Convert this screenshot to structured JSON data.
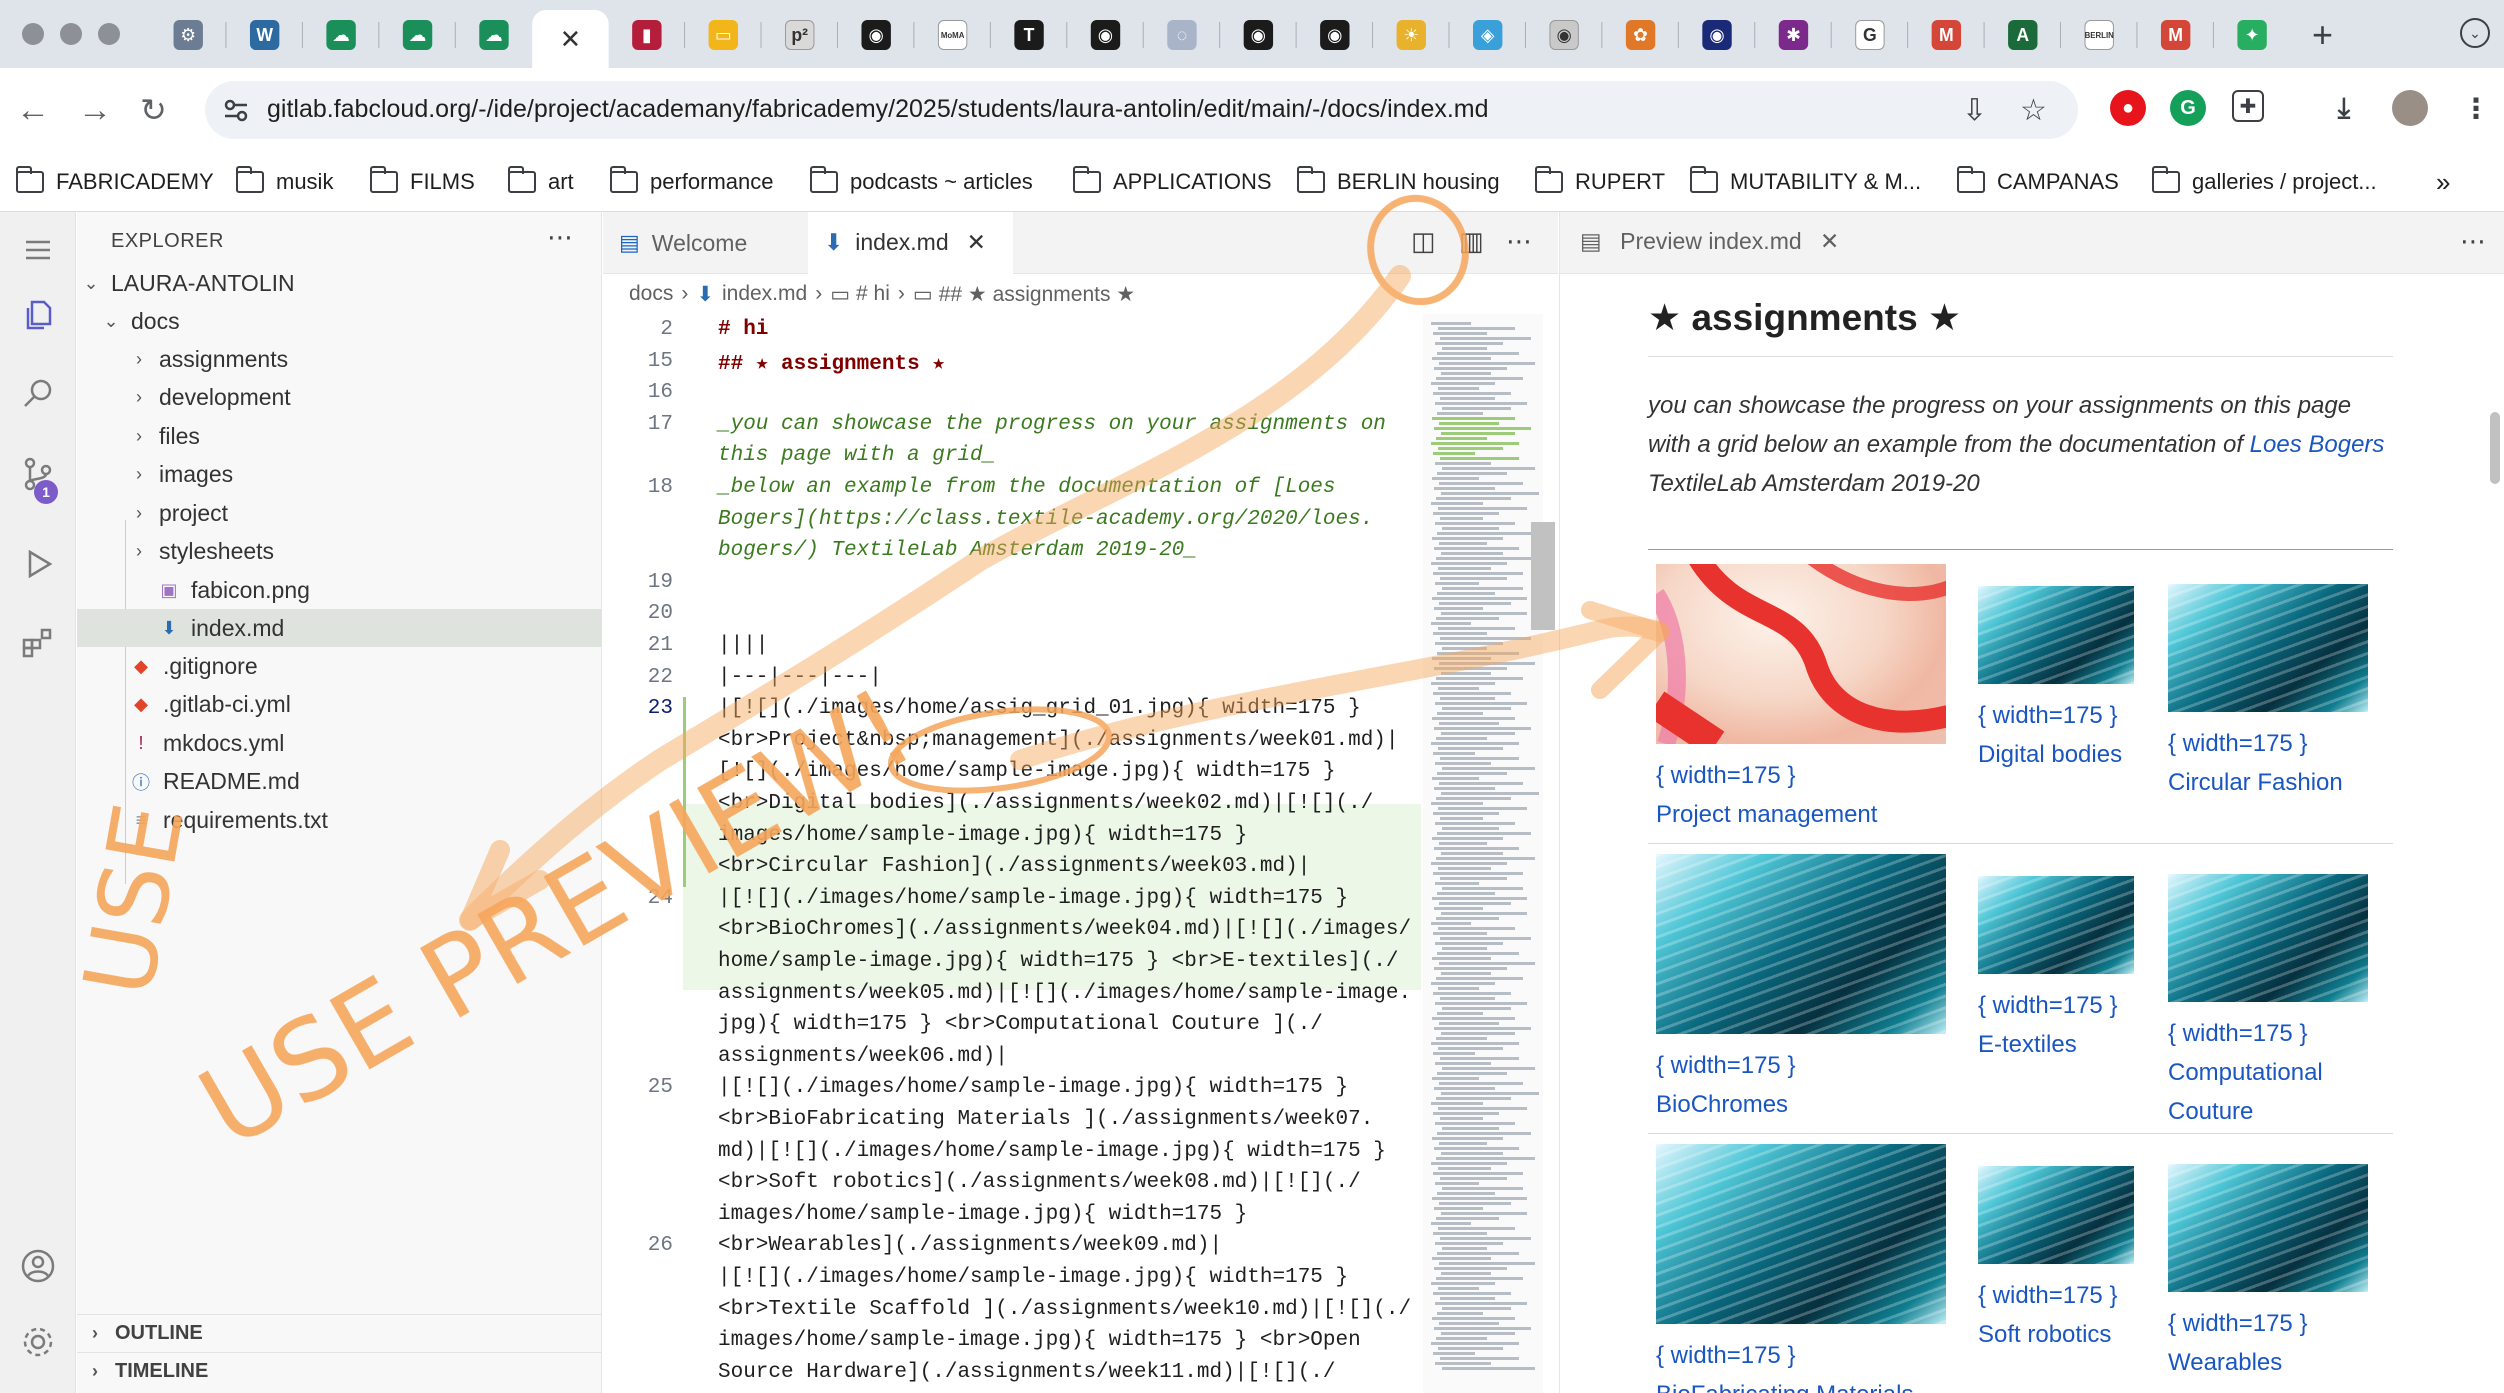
{
  "browser": {
    "tab_icons": [
      "settings-favicon",
      "wordpress-favicon",
      "cloud-favicon",
      "cloud-favicon",
      "cloud-favicon",
      "ide-favicon-active",
      "chart-favicon",
      "slides-favicon",
      "p2-favicon",
      "notion-favicon",
      "moma-favicon",
      "text-favicon",
      "notion-favicon",
      "loading-favicon",
      "notion-favicon",
      "notion-favicon",
      "sun-favicon",
      "cube-favicon",
      "panda-favicon",
      "bird-favicon",
      "circle-favicon",
      "slack-favicon",
      "google-favicon",
      "gmail-favicon",
      "a-favicon",
      "berlin-favicon",
      "gmail-favicon",
      "puzzle-favicon"
    ],
    "address": "gitlab.fabcloud.org/-/ide/project/academany/fabricademy/2025/students/laura-antolin/edit/main/-/docs/index.md",
    "bookmarks": [
      "FABRICADEMY",
      "musik",
      "FILMS",
      "art",
      "performance",
      "podcasts ~ articles",
      "APPLICATIONS",
      "BERLIN housing",
      "RUPERT",
      "MUTABILITY & M...",
      "CAMPANAS",
      "galleries / project..."
    ],
    "more_bookmarks": "»"
  },
  "sidebar": {
    "title": "EXPLORER",
    "root": "LAURA-ANTOLIN",
    "docs_folder": "docs",
    "docs_children": [
      "assignments",
      "development",
      "files",
      "images",
      "project",
      "stylesheets"
    ],
    "docs_files": [
      "fabicon.png",
      "index.md"
    ],
    "root_files": [
      ".gitignore",
      ".gitlab-ci.yml",
      "mkdocs.yml",
      "README.md",
      "requirements.txt"
    ],
    "outline": "OUTLINE",
    "timeline": "TIMELINE",
    "scm_badge": "1"
  },
  "editor": {
    "tabs": [
      "Welcome",
      "index.md"
    ],
    "breadcrumb": [
      "docs",
      "index.md",
      "# hi",
      "## ★ assignments ★"
    ],
    "line_numbers": [
      "2",
      "15",
      "16",
      "17",
      "",
      "18",
      "",
      "",
      "19",
      "20",
      "21",
      "22",
      "23",
      "",
      "",
      "",
      "",
      "",
      "24",
      "",
      "",
      "",
      "",
      "",
      "25",
      "",
      "",
      "",
      "",
      "26",
      "",
      "",
      ""
    ],
    "lines": [
      "# hi",
      "## ★ assignments ★",
      "",
      "_you can showcase the progress on your assignments on",
      "this page with a grid_",
      "_below an example from the documentation of [Loes",
      "Bogers](https://class.textile-academy.org/2020/loes.",
      "bogers/) TextileLab Amsterdam 2019-20_",
      "",
      "",
      "||||",
      "|---|---|---|",
      "|[![](./images/home/assig_grid_01.jpg){ width=175 }",
      "<br>Project&nbsp;management](./assignments/week01.md)|",
      "[![](./images/home/sample-image.jpg){ width=175 }",
      "<br>Digital bodies](./assignments/week02.md)|[![](./",
      "images/home/sample-image.jpg){ width=175 }",
      "<br>Circular Fashion](./assignments/week03.md)|",
      "|[![](./images/home/sample-image.jpg){ width=175 }",
      "<br>BioChromes](./assignments/week04.md)|[![](./images/",
      "home/sample-image.jpg){ width=175 } <br>E-textiles](./",
      "assignments/week05.md)|[![](./images/home/sample-image.",
      "jpg){ width=175 } <br>Computational Couture ](./",
      "assignments/week06.md)|",
      "|[![](./images/home/sample-image.jpg){ width=175 }",
      "<br>BioFabricating Materials ](./assignments/week07.",
      "md)|[![](./images/home/sample-image.jpg){ width=175 }",
      "<br>Soft robotics](./assignments/week08.md)|[![](./",
      "images/home/sample-image.jpg){ width=175 }",
      "<br>Wearables](./assignments/week09.md)|",
      "|[![](./images/home/sample-image.jpg){ width=175 }",
      "<br>Textile Scaffold ](./assignments/week10.md)|[![](./",
      "images/home/sample-image.jpg){ width=175 } <br>Open",
      "Source Hardware](./assignments/week11.md)|[![](./"
    ]
  },
  "preview": {
    "tab": "Preview index.md",
    "heading": "★ assignments ★",
    "intro_before_link": "you can showcase the progress on your assignments on this page with a grid below an example from the documentation of ",
    "intro_link": "Loes Bogers",
    "intro_after_link": " TextileLab Amsterdam 2019-20",
    "width_label": "{ width=175 }",
    "items": [
      "Project management",
      "Digital bodies",
      "Circular Fashion",
      "BioChromes",
      "E-textiles",
      "Computational Couture",
      "BioFabricating Materials",
      "Soft robotics",
      "Wearables"
    ]
  },
  "annotation": {
    "text": "USE PREVIEW!",
    "color": "#f5a65b"
  }
}
